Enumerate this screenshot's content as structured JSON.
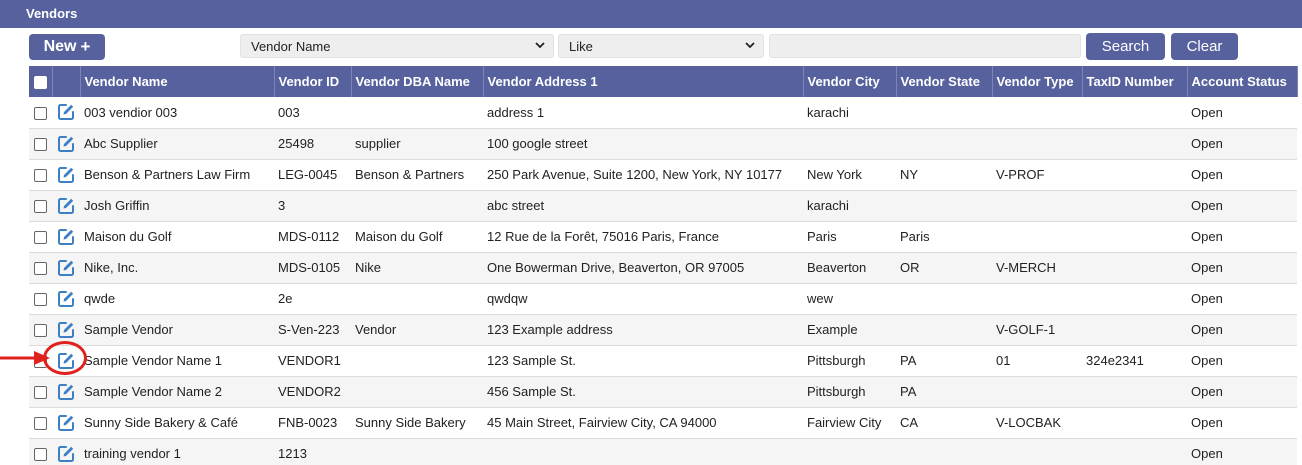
{
  "title": "Vendors",
  "toolbar": {
    "new_label": "New",
    "new_icon": "plus-icon",
    "field_select": "Vendor Name",
    "operator_select": "Like",
    "search_value": "",
    "search_label": "Search",
    "clear_label": "Clear"
  },
  "columns": [
    "Vendor Name",
    "Vendor ID",
    "Vendor DBA Name",
    "Vendor Address 1",
    "Vendor City",
    "Vendor State",
    "Vendor Type",
    "TaxID Number",
    "Account Status"
  ],
  "rows": [
    [
      "003 vendior 003",
      "003",
      "",
      "address 1",
      "karachi",
      "",
      "",
      "",
      "Open"
    ],
    [
      "Abc Supplier",
      "25498",
      "supplier",
      "100 google street",
      "",
      "",
      "",
      "",
      "Open"
    ],
    [
      "Benson & Partners Law Firm",
      "LEG-0045",
      "Benson & Partners",
      "250 Park Avenue, Suite 1200, New York, NY 10177",
      "New York",
      "NY",
      "V-PROF",
      "",
      "Open"
    ],
    [
      "Josh Griffin",
      "3",
      "",
      "abc street",
      "karachi",
      "",
      "",
      "",
      "Open"
    ],
    [
      "Maison du Golf",
      "MDS-0112",
      "Maison du Golf",
      "12 Rue de la Forêt, 75016 Paris, France",
      "Paris",
      "Paris",
      "",
      "",
      "Open"
    ],
    [
      "Nike, Inc.",
      "MDS-0105",
      "Nike",
      "One Bowerman Drive, Beaverton, OR 97005",
      "Beaverton",
      "OR",
      "V-MERCH",
      "",
      "Open"
    ],
    [
      "qwde",
      "2e",
      "",
      "qwdqw",
      "wew",
      "",
      "",
      "",
      "Open"
    ],
    [
      "Sample Vendor",
      "S-Ven-223",
      "Vendor",
      "123 Example address",
      "Example",
      "",
      "V-GOLF-1",
      "",
      "Open"
    ],
    [
      "Sample Vendor Name 1",
      "VENDOR1",
      "",
      "123 Sample St.",
      "Pittsburgh",
      "PA",
      "01",
      "324e2341",
      "Open"
    ],
    [
      "Sample Vendor Name 2",
      "VENDOR2",
      "",
      "456 Sample St.",
      "Pittsburgh",
      "PA",
      "",
      "",
      "Open"
    ],
    [
      "Sunny Side Bakery & Café",
      "FNB-0023",
      "Sunny Side Bakery",
      "45 Main Street, Fairview City, CA 94000",
      "Fairview City",
      "CA",
      "V-LOCBAK",
      "",
      "Open"
    ],
    [
      "training vendor 1",
      "1213",
      "",
      "",
      "",
      "",
      "",
      "",
      "Open"
    ]
  ],
  "colors": {
    "header_bg": "#56619e",
    "annotation": "#e0221f",
    "edit_icon": "#3d7fc4"
  },
  "annotation": {
    "arrow_icon": "red-arrow-icon",
    "circle_icon": "red-circle-highlight"
  }
}
